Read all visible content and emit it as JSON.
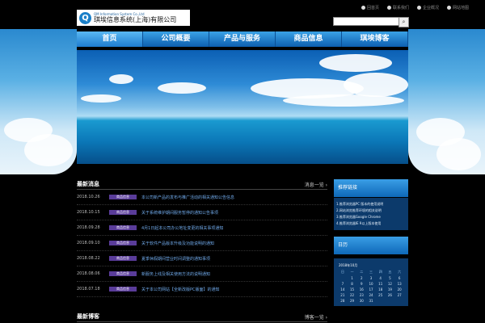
{
  "logo": {
    "en": "QM Information System Co.,Ltd",
    "cn": "琪埃信息系统(上海)有限公司",
    "mark": "Q"
  },
  "toplinks": [
    "回首页",
    "联系我们",
    "企业概况",
    "网站地图"
  ],
  "search": {
    "placeholder": "",
    "button_icon": "search-icon"
  },
  "nav": [
    {
      "label": "首页",
      "active": true
    },
    {
      "label": "公司概要",
      "active": false
    },
    {
      "label": "产品与服务",
      "active": false
    },
    {
      "label": "商品信息",
      "active": false
    },
    {
      "label": "琪埃博客",
      "active": false
    }
  ],
  "news": {
    "title": "最新消息",
    "more": "消息一览 ›",
    "items": [
      {
        "date": "2018.10.26",
        "cat": "商品信息",
        "title": "本公司新产品的发布与推广活动的相关通知公告信息"
      },
      {
        "date": "2018.10.15",
        "cat": "商品信息",
        "title": "关于系统维护期间服务暂停的通知公告事项"
      },
      {
        "date": "2018.09.28",
        "cat": "商品信息",
        "title": "4月1日起本公司办公地址变更的相关事项通知"
      },
      {
        "date": "2018.09.10",
        "cat": "商品信息",
        "title": "关于软件产品版本升级及功能说明的通知"
      },
      {
        "date": "2018.08.22",
        "cat": "商品信息",
        "title": "夏季休假期间营业时间调整的通知事项"
      },
      {
        "date": "2018.08.06",
        "cat": "商品信息",
        "title": "新服务上线及相关使用方法的说明通知"
      },
      {
        "date": "2018.07.18",
        "cat": "商品信息",
        "title": "关于本公司网站【全新改版PC版面】的通知"
      }
    ]
  },
  "blog": {
    "title": "最新博客",
    "more": "博客一览 ›"
  },
  "sidebar": {
    "links_title": "推荐链接",
    "links": [
      "1.推荐浏览器PC 版本的使用说明",
      "2.网站浏览推荐环境的相关说明",
      "3.推荐浏览器Google Chrome",
      "4.推荐浏览器IE 9以上版本使用"
    ],
    "cal_box_title": "日历",
    "calendar": {
      "title": "2018年10月",
      "headers": [
        "日",
        "一",
        "二",
        "三",
        "四",
        "五",
        "六"
      ],
      "cells": [
        "",
        "1",
        "2",
        "3",
        "4",
        "5",
        "6",
        "7",
        "8",
        "9",
        "10",
        "11",
        "12",
        "13",
        "14",
        "15",
        "16",
        "17",
        "18",
        "19",
        "20",
        "21",
        "22",
        "23",
        "24",
        "25",
        "26",
        "27",
        "28",
        "29",
        "30",
        "31"
      ]
    }
  },
  "colors": {
    "nav_top": "#3aa2e6",
    "nav_bottom": "#0d5fb0",
    "category_badge": "#5a3c9a",
    "link": "#6fa8e8"
  }
}
